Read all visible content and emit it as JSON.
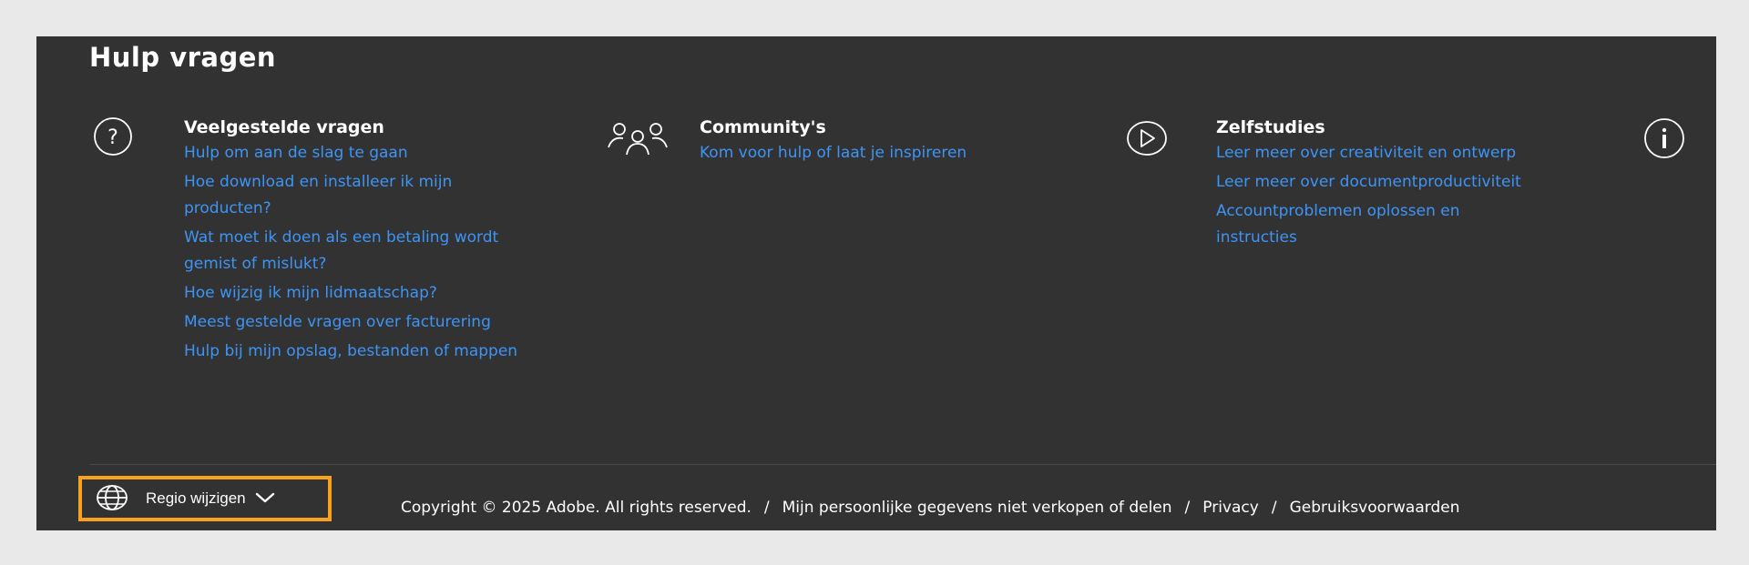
{
  "section": {
    "title": "Hulp vragen"
  },
  "columns": [
    {
      "icon": "question-circle-icon",
      "heading": "Veelgestelde vragen",
      "links": [
        "Hulp om aan de slag te gaan",
        "Hoe download en installeer ik mijn producten?",
        "Wat moet ik doen als een betaling wordt gemist of mislukt?",
        "Hoe wijzig ik mijn lidmaatschap?",
        "Meest gestelde vragen over facturering",
        "Hulp bij mijn opslag, bestanden of mappen"
      ]
    },
    {
      "icon": "people-group-icon",
      "heading": "Community's",
      "links": [
        "Kom voor hulp of laat je inspireren"
      ]
    },
    {
      "icon": "play-circle-icon",
      "heading": "Zelfstudies",
      "links": [
        "Leer meer over creativiteit en ontwerp",
        "Leer meer over documentproductiviteit",
        "Accountproblemen oplossen en instructies"
      ]
    },
    {
      "icon": "info-circle-icon"
    }
  ],
  "footer": {
    "region_label": "Regio wijzigen",
    "copyright": "Copyright © 2025 Adobe. All rights reserved.",
    "separator": "/",
    "links": [
      "Mijn persoonlijke gegevens niet verkopen of delen",
      "Privacy",
      "Gebruiksvoorwaarden"
    ]
  },
  "colors": {
    "panel": "#323232",
    "link": "#3e94f5",
    "highlight": "#f7a21e"
  }
}
